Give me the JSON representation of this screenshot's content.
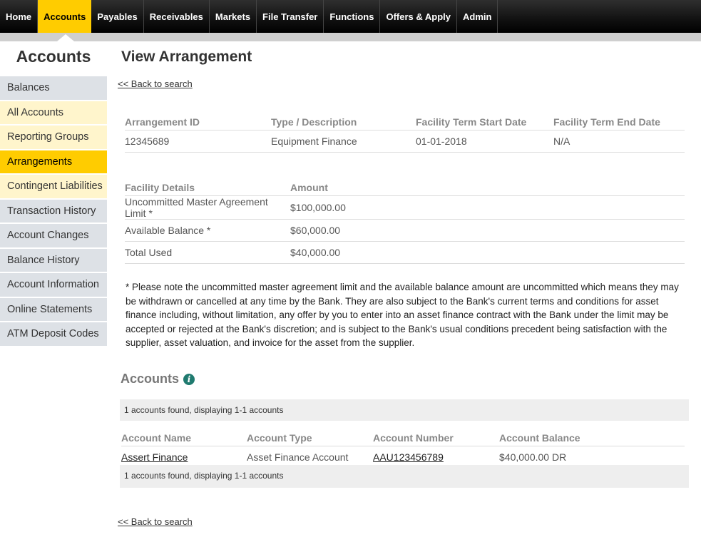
{
  "nav": {
    "tabs": [
      "Home",
      "Accounts",
      "Payables",
      "Receivables",
      "Markets",
      "File Transfer",
      "Functions",
      "Offers & Apply",
      "Admin"
    ],
    "active": "Accounts"
  },
  "sidebar": {
    "title": "Accounts",
    "items": [
      {
        "label": "Balances"
      },
      {
        "label": "All Accounts"
      },
      {
        "label": "Reporting Groups"
      },
      {
        "label": "Arrangements"
      },
      {
        "label": "Contingent Liabilities"
      },
      {
        "label": "Transaction History"
      },
      {
        "label": "Account Changes"
      },
      {
        "label": "Balance History"
      },
      {
        "label": "Account Information"
      },
      {
        "label": "Online Statements"
      },
      {
        "label": "ATM Deposit Codes"
      }
    ]
  },
  "main": {
    "title": "View Arrangement",
    "back_link": "<< Back to search",
    "arrangement": {
      "headers": [
        "Arrangement ID",
        "Type / Description",
        "Facility Term Start Date",
        "Facility Term End Date"
      ],
      "row": [
        "12345689",
        "Equipment Finance",
        "01-01-2018",
        "N/A"
      ]
    },
    "facility": {
      "headers": [
        "Facility Details",
        "Amount"
      ],
      "rows": [
        [
          "Uncommitted Master Agreement Limit *",
          "$100,000.00"
        ],
        [
          "Available Balance *",
          "$60,000.00"
        ],
        [
          "Total Used",
          "$40,000.00"
        ]
      ]
    },
    "note": "* Please note the uncommitted master agreement limit and the available balance amount are uncommitted which means they may be withdrawn or cancelled at any time by the Bank. They are also subject to the Bank's current terms and conditions for asset finance including, without limitation, any offer by you to enter into an asset finance contract with the Bank under the limit may be accepted or rejected at the Bank's discretion; and is subject to the Bank's usual conditions precedent being satisfaction with the supplier, asset valuation, and invoice for the asset from the supplier.",
    "accounts": {
      "heading": "Accounts",
      "info_icon": "i",
      "count_text": "1 accounts found, displaying 1-1 accounts",
      "headers": [
        "Account Name",
        "Account Type",
        "Account Number",
        "Account Balance"
      ],
      "rows": [
        [
          "Assert Finance",
          "Asset Finance Account",
          "AAU123456789",
          "$40,000.00 DR"
        ]
      ]
    }
  },
  "colors": {
    "accent": "#ffcc00",
    "nav_bg": "#111111",
    "info": "#1f7a6f"
  }
}
